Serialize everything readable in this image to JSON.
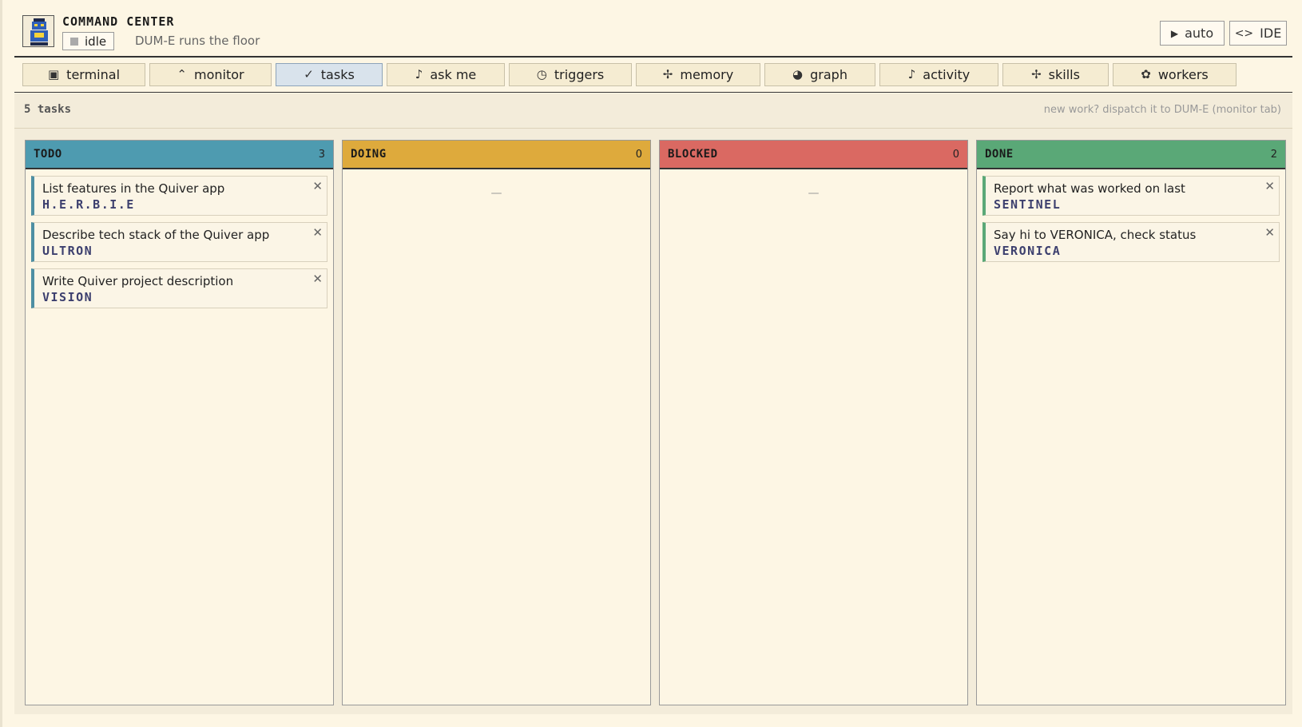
{
  "header": {
    "title": "COMMAND CENTER",
    "status_label": "idle",
    "status_text": "DUM-E runs the floor",
    "auto_label": "auto",
    "ide_label": "IDE"
  },
  "tabs": [
    {
      "label": "terminal",
      "icon": "terminal-icon"
    },
    {
      "label": "monitor",
      "icon": "monitor-icon"
    },
    {
      "label": "tasks",
      "icon": "check-icon",
      "active": true
    },
    {
      "label": "ask me",
      "icon": "bell-icon"
    },
    {
      "label": "triggers",
      "icon": "clock-icon"
    },
    {
      "label": "memory",
      "icon": "sparkle-icon"
    },
    {
      "label": "graph",
      "icon": "graph-icon"
    },
    {
      "label": "activity",
      "icon": "bell-icon"
    },
    {
      "label": "skills",
      "icon": "sparkle-icon"
    },
    {
      "label": "workers",
      "icon": "gear-icon"
    }
  ],
  "subbar": {
    "task_count": "5 tasks",
    "hint": "new work? dispatch it to DUM-E (monitor tab)"
  },
  "columns": [
    {
      "title": "TODO",
      "count": "3",
      "color": "#4e9bb0",
      "cards": [
        {
          "title": "List features in the Quiver app",
          "agent": "H.E.R.B.I.E"
        },
        {
          "title": "Describe tech stack of the Quiver app",
          "agent": "ULTRON"
        },
        {
          "title": "Write Quiver project description",
          "agent": "VISION"
        }
      ]
    },
    {
      "title": "DOING",
      "count": "0",
      "color": "#deaa3c",
      "empty": "—"
    },
    {
      "title": "BLOCKED",
      "count": "0",
      "color": "#da6962",
      "empty": "—"
    },
    {
      "title": "DONE",
      "count": "2",
      "color": "#5aa877",
      "cards": [
        {
          "title": "Report what was worked on last",
          "agent": "SENTINEL"
        },
        {
          "title": "Say hi to VERONICA, check status",
          "agent": "VERONICA"
        }
      ]
    }
  ],
  "close_glyph": "✕"
}
